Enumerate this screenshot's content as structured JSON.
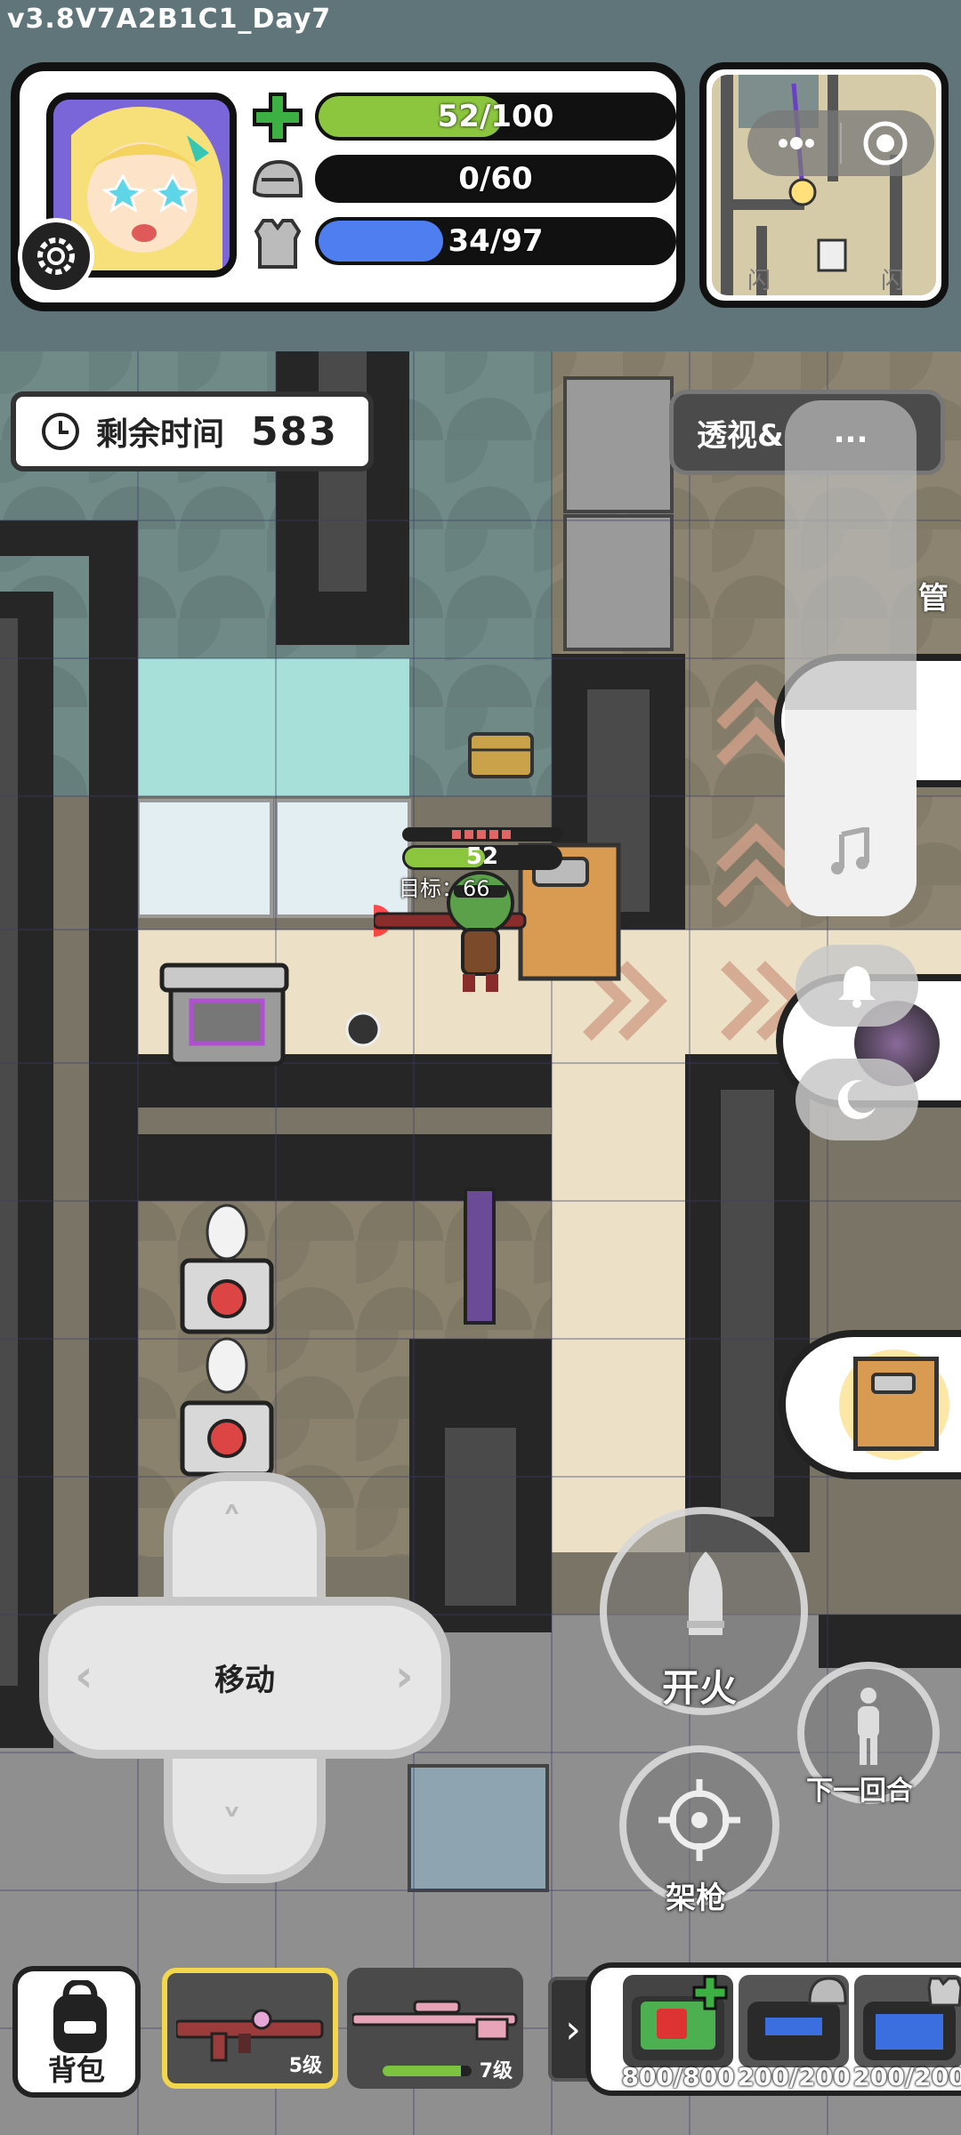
{
  "version": "v3.8V7A2B1C1_Day7",
  "status": {
    "health": {
      "text": "52/100",
      "value": 52,
      "max": 100,
      "color": "#8cc63f"
    },
    "helmet": {
      "text": "0/60",
      "value": 0,
      "max": 60,
      "color": "#9a9a9a"
    },
    "armor": {
      "text": "34/97",
      "value": 34,
      "max": 97,
      "color": "#4f7ef0"
    }
  },
  "minimap": {
    "labels": [
      "闪",
      "闪"
    ]
  },
  "timer": {
    "label": "剩余时间",
    "value": "583"
  },
  "xray_button": {
    "label": "透视&"
  },
  "side_panel": {
    "more": "...",
    "side_text": "管"
  },
  "player": {
    "health": "52",
    "target": "目标：66"
  },
  "controls": {
    "move": "移动",
    "fire": "开火",
    "aim": "架枪",
    "next_round": "下一回合"
  },
  "bottom": {
    "bag": "背包",
    "weapons": [
      {
        "level": "5级",
        "selected": true
      },
      {
        "level": "7级",
        "selected": false
      }
    ],
    "supplies": [
      {
        "count": "800/800",
        "icon": "medkit-icon",
        "color": "#43a047"
      },
      {
        "count": "200/200",
        "icon": "helmet-bag-icon",
        "color": "#9a9a9a"
      },
      {
        "count": "200/200",
        "icon": "armor-bag-icon",
        "color": "#3b6fe0"
      }
    ]
  },
  "colors": {
    "accent_selected": "#f2d64b",
    "hud_bg": "#5f7579"
  }
}
